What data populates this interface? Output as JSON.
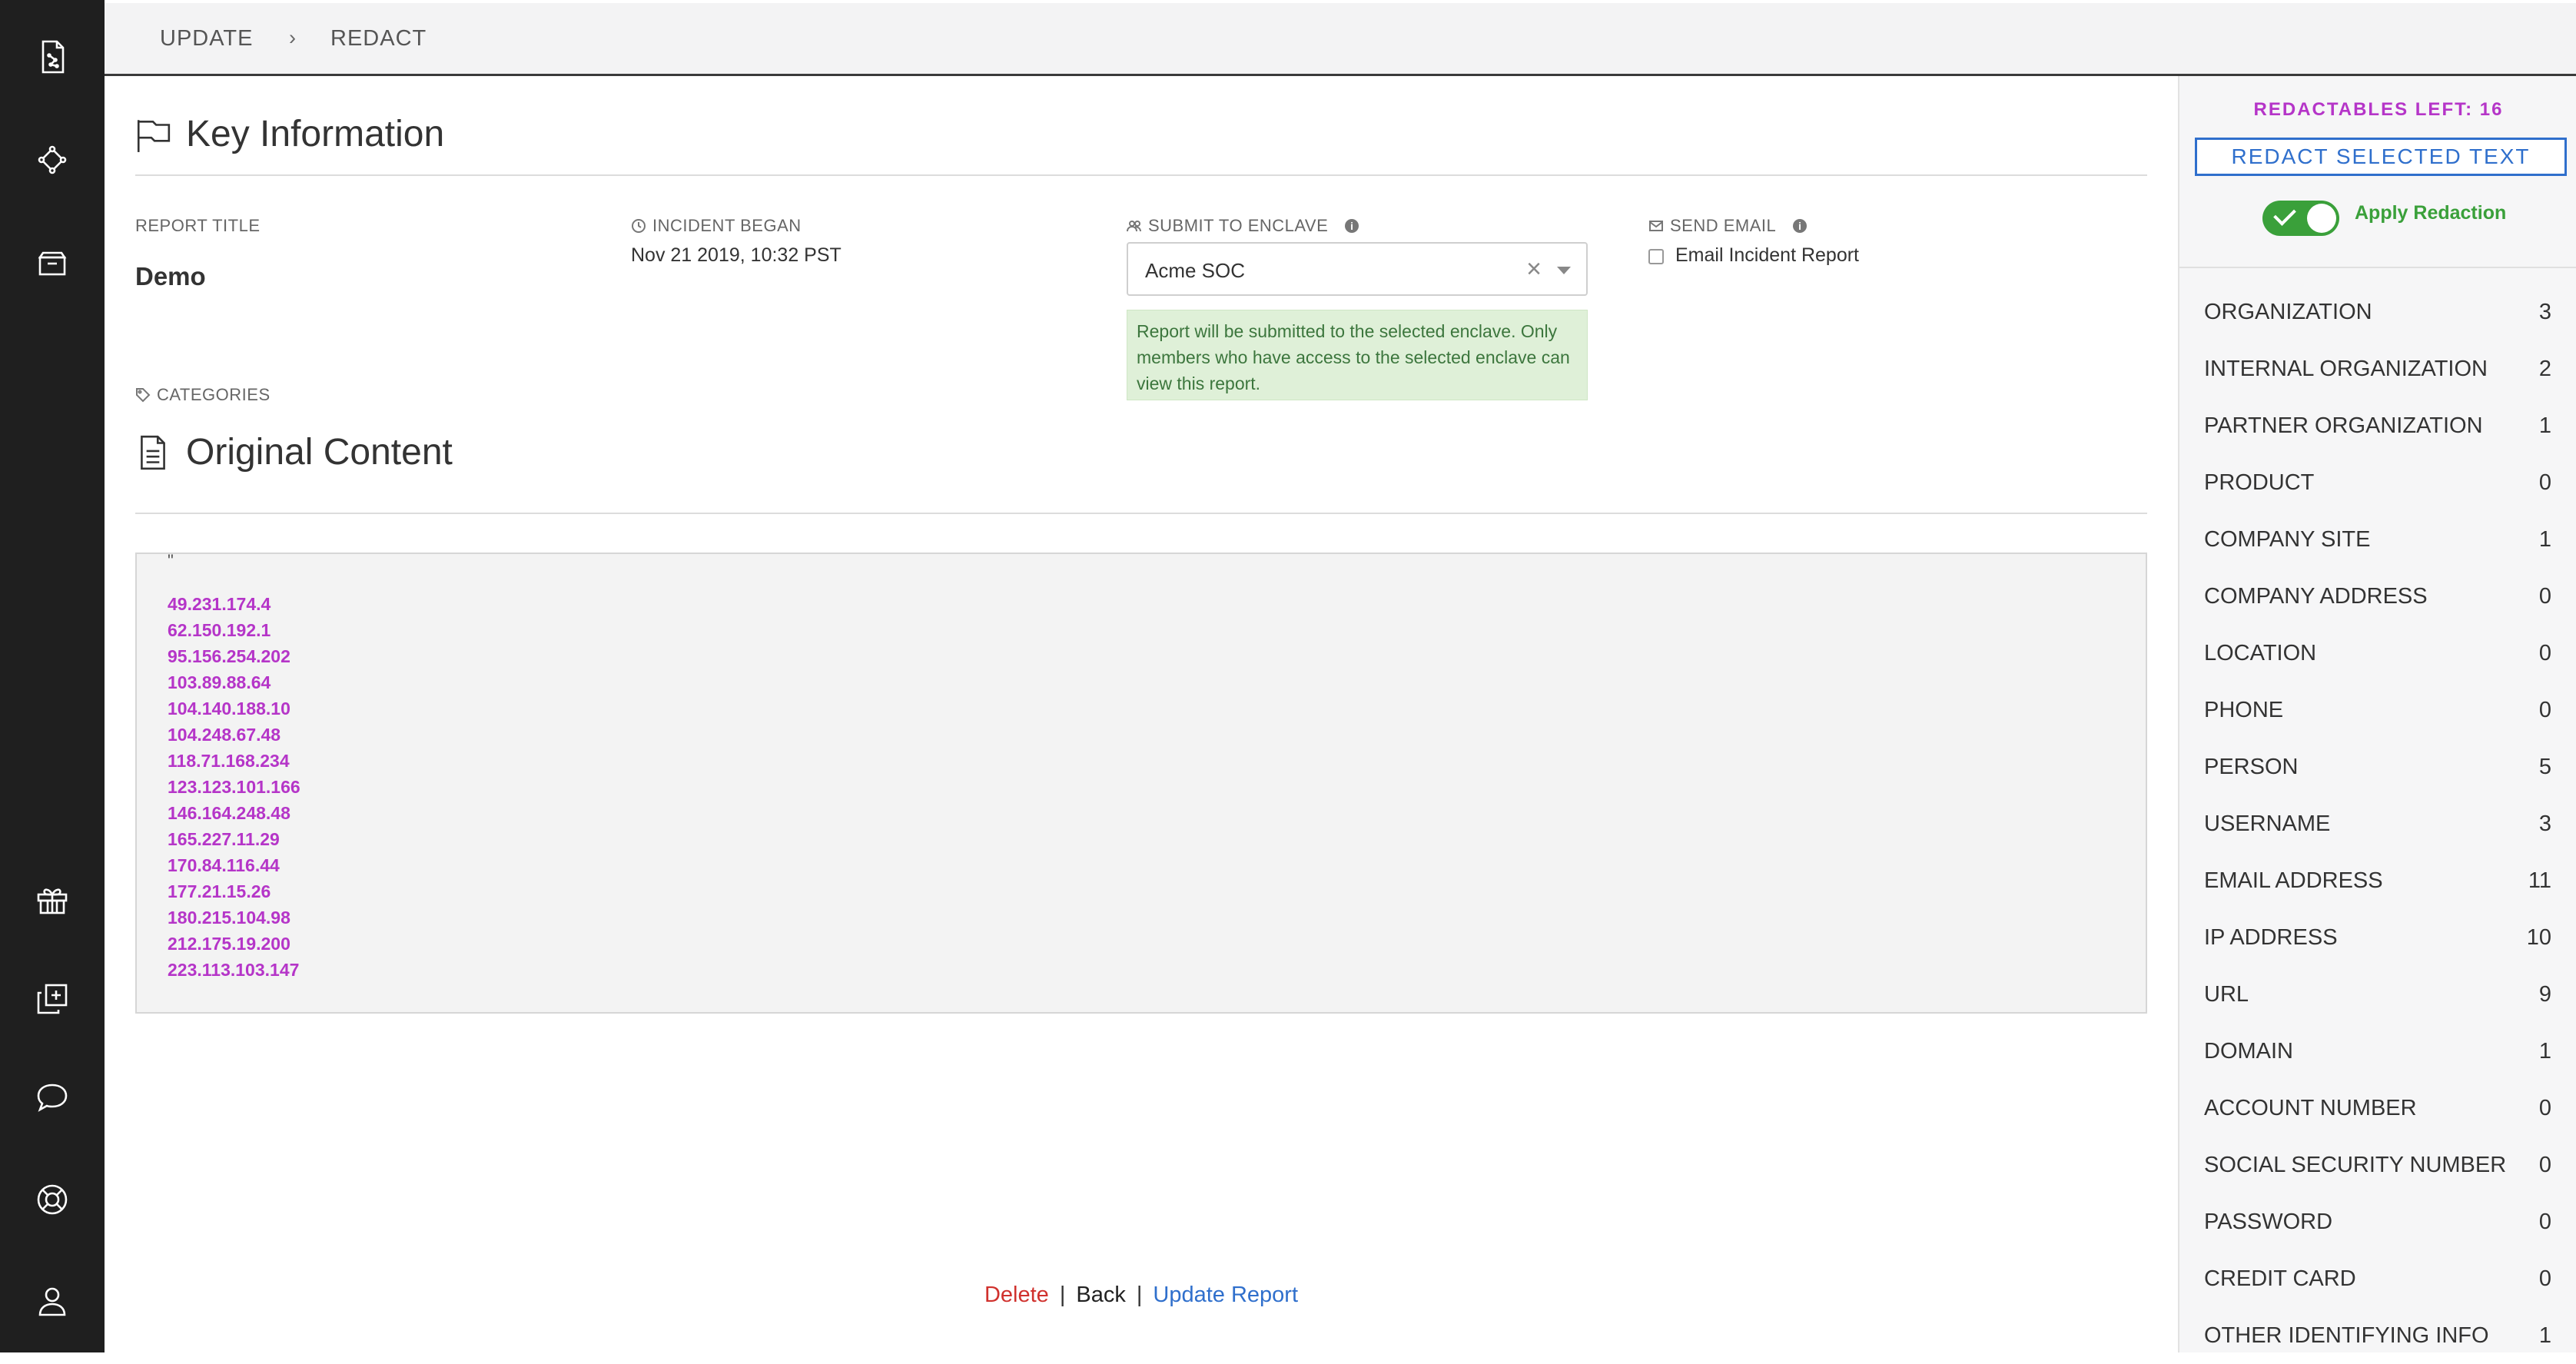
{
  "breadcrumb": {
    "items": [
      "UPDATE",
      "REDACT"
    ],
    "separator": "›"
  },
  "key_information": {
    "title": "Key Information",
    "report_title_label": "REPORT TITLE",
    "report_title_value": "Demo",
    "incident_began_label": "INCIDENT BEGAN",
    "incident_began_value": "Nov 21 2019, 10:32 PST",
    "submit_enclave_label": "SUBMIT TO ENCLAVE",
    "enclave_selected": "Acme SOC",
    "enclave_note": "Report will be submitted to the selected enclave. Only members who have access to the selected enclave can view this report.",
    "send_email_label": "SEND EMAIL",
    "email_checkbox_label": "Email Incident Report",
    "categories_label": "CATEGORIES"
  },
  "original_content": {
    "title": "Original Content",
    "quote_char": "\"",
    "ips": [
      "49.231.174.4",
      "62.150.192.1",
      "95.156.254.202",
      "103.89.88.64",
      "104.140.188.10",
      "104.248.67.48",
      "118.71.168.234",
      "123.123.101.166",
      "146.164.248.48",
      "165.227.11.29",
      "170.84.116.44",
      "177.21.15.26",
      "180.215.104.98",
      "212.175.19.200",
      "223.113.103.147"
    ]
  },
  "footer": {
    "delete": "Delete",
    "back": "Back",
    "update": "Update Report",
    "separator": "|"
  },
  "redact_panel": {
    "redactables_left": "REDACTABLES LEFT: 16",
    "redact_button": "REDACT SELECTED TEXT",
    "apply_redaction_label": "Apply Redaction",
    "apply_redaction_on": true,
    "items": [
      {
        "label": "ORGANIZATION",
        "count": "3"
      },
      {
        "label": "INTERNAL ORGANIZATION",
        "count": "2"
      },
      {
        "label": "PARTNER ORGANIZATION",
        "count": "1"
      },
      {
        "label": "PRODUCT",
        "count": "0"
      },
      {
        "label": "COMPANY SITE",
        "count": "1"
      },
      {
        "label": "COMPANY ADDRESS",
        "count": "0"
      },
      {
        "label": "LOCATION",
        "count": "0"
      },
      {
        "label": "PHONE",
        "count": "0"
      },
      {
        "label": "PERSON",
        "count": "5"
      },
      {
        "label": "USERNAME",
        "count": "3"
      },
      {
        "label": "EMAIL ADDRESS",
        "count": "11"
      },
      {
        "label": "IP ADDRESS",
        "count": "10"
      },
      {
        "label": "URL",
        "count": "9"
      },
      {
        "label": "DOMAIN",
        "count": "1"
      },
      {
        "label": "ACCOUNT NUMBER",
        "count": "0"
      },
      {
        "label": "SOCIAL SECURITY NUMBER",
        "count": "0"
      },
      {
        "label": "PASSWORD",
        "count": "0"
      },
      {
        "label": "CREDIT CARD",
        "count": "0"
      },
      {
        "label": "OTHER IDENTIFYING INFO",
        "count": "1"
      }
    ]
  },
  "colors": {
    "sidebar": "#1f1f1f",
    "ip_text": "#b535c8",
    "accent_blue": "#2f6fcc",
    "toggle_green": "#3aa03a",
    "delete_red": "#d0312d",
    "note_bg": "#dff0d8"
  }
}
